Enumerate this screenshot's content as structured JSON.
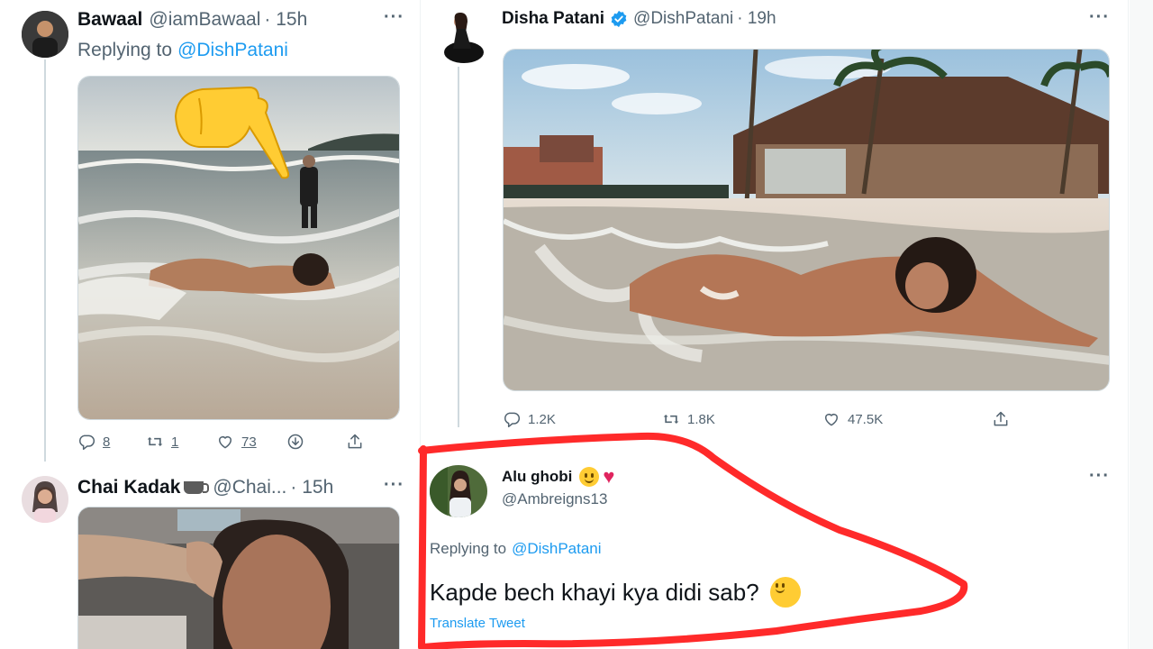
{
  "left": {
    "tweet1": {
      "name": "Bawaal",
      "handle": "@iamBawaal",
      "time": "· 15h",
      "replying_prefix": "Replying to",
      "replying_handle": "@DishPatani",
      "replies": "8",
      "retweets": "1",
      "likes": "73"
    },
    "tweet2": {
      "name": "Chai Kadak",
      "handle": "@Chai...",
      "time": "· 15h"
    }
  },
  "main": {
    "tweet": {
      "name": "Disha Patani",
      "handle": "@DishPatani",
      "time": "· 19h",
      "replies": "1.2K",
      "retweets": "1.8K",
      "likes": "47.5K"
    },
    "reply": {
      "name": "Alu ghobi",
      "handle": "@Ambreigns13",
      "replying_prefix": "Replying to",
      "replying_handle": "@DishPatani",
      "text": "Kapde bech khayi kya didi sab?",
      "translate": "Translate Tweet"
    }
  },
  "icons": [
    "reply-icon",
    "retweet-icon",
    "like-icon",
    "share-icon",
    "more-icon",
    "verified-icon",
    "pointing-hand-emoji",
    "smile-emoji",
    "heart-emoji",
    "coffee-emoji"
  ],
  "colors": {
    "accent": "#1d9bf0",
    "muted": "#536471",
    "annotation": "#ff2a2a"
  }
}
